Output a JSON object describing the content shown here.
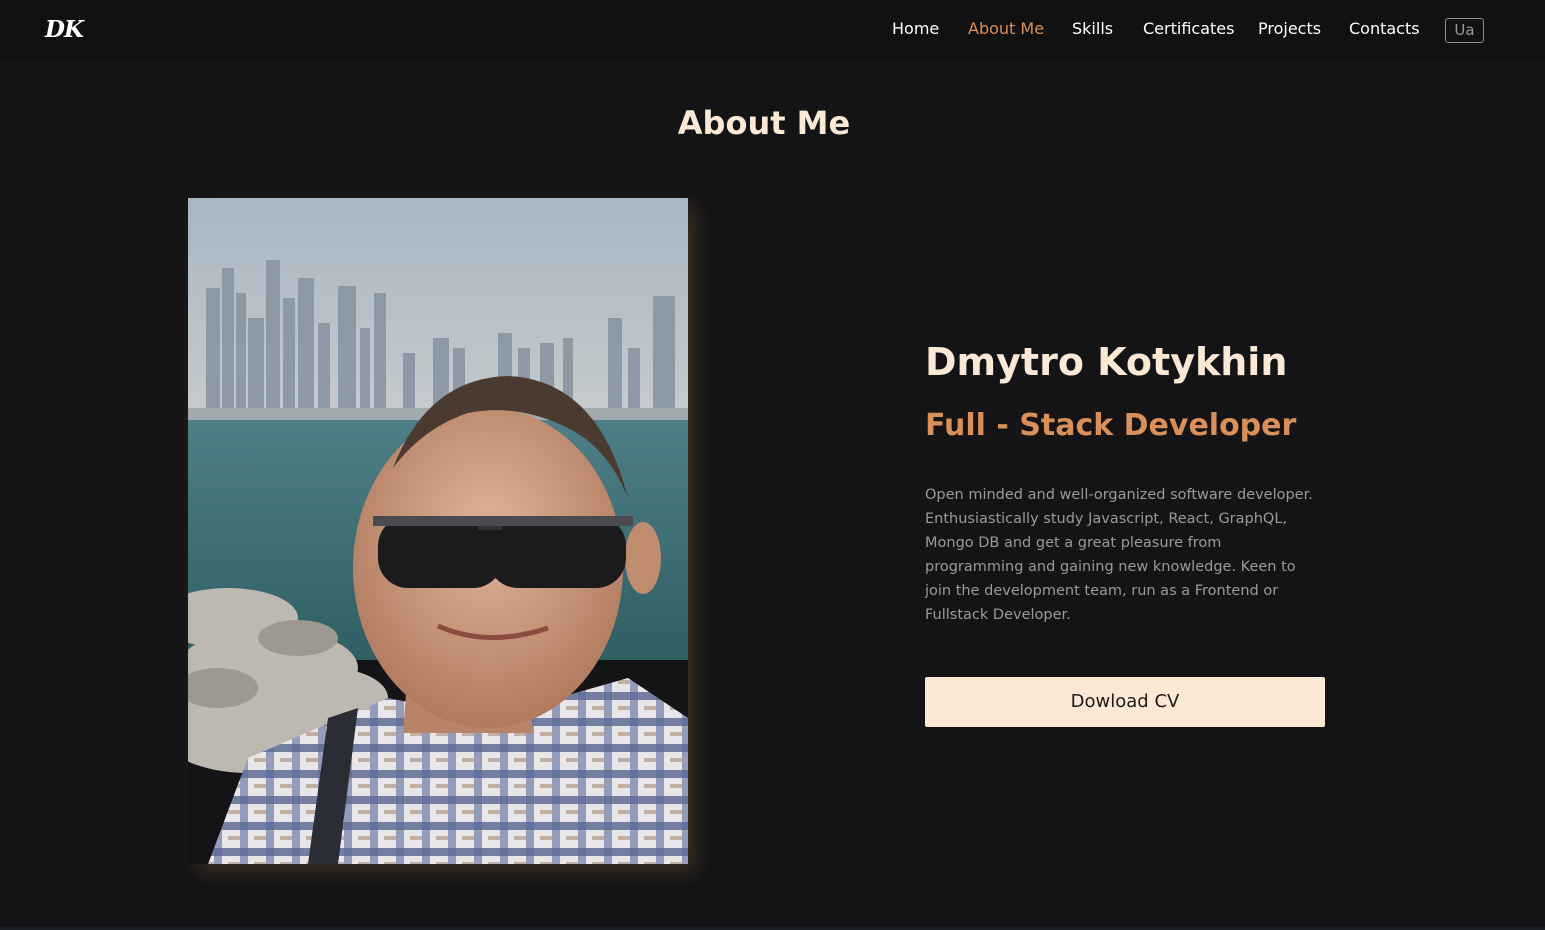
{
  "header": {
    "logo": "DK",
    "nav": [
      {
        "label": "Home"
      },
      {
        "label": "About Me",
        "active": true
      },
      {
        "label": "Skills"
      },
      {
        "label": "Certificates"
      },
      {
        "label": "Projects"
      },
      {
        "label": "Contacts"
      }
    ],
    "language_button": "Ua"
  },
  "about": {
    "title": "About Me",
    "name": "Dmytro Kotykhin",
    "role": "Full - Stack Developer",
    "bio_lines": [
      "Open minded and well-organized software developer.",
      "Enthusiastically study Javascript, React, GraphQL,",
      "Mongo DB and get a great pleasure from",
      "programming and gaining new knowledge. Keen to",
      "join the development team, run as a Frontend or",
      "Fullstack Developer."
    ],
    "cv_button": "Dowload CV"
  },
  "colors": {
    "background": "#141416",
    "navbar": "#111112",
    "accent": "#d98f57",
    "cream": "#fbe9d5",
    "muted_text": "#9a9a9a"
  },
  "icons": {
    "logo": "dk-monogram-logo"
  }
}
